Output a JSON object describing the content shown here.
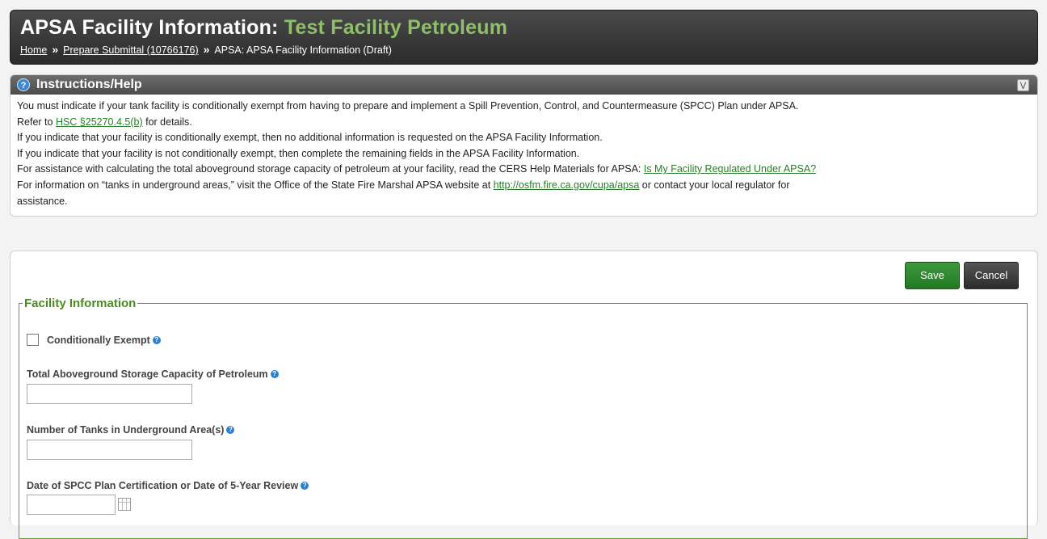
{
  "header": {
    "title_prefix": "APSA Facility Information: ",
    "facility_name": "Test Facility Petroleum",
    "breadcrumb": {
      "home": "Home",
      "sep": "»",
      "prepare": "Prepare Submittal (10766176)",
      "current": "APSA: APSA Facility Information (Draft)"
    }
  },
  "help": {
    "title": "Instructions/Help",
    "toggle_icon": "chevron-down-icon",
    "line1_a": "You must indicate if your tank facility is conditionally exempt from having to prepare and implement a Spill Prevention, Control, and Countermeasure (SPCC) Plan under APSA.",
    "line1_b_prefix": "Refer to ",
    "line1_b_link": "HSC §25270.4.5(b)",
    "line1_b_suffix": " for details.",
    "line2": "If you indicate that your facility is conditionally exempt, then no additional information is requested on the APSA Facility Information.",
    "line3": "If you indicate that your facility is not conditionally exempt, then complete the remaining fields in the APSA Facility Information.",
    "line4_prefix": "For assistance with calculating the total aboveground storage capacity of petroleum at your facility, read the CERS Help Materials for APSA: ",
    "line4_link": "Is My Facility Regulated Under APSA?",
    "line5_prefix": "For information on “tanks in underground areas,” visit the Office of the State Fire Marshal APSA website at ",
    "line5_link": "http://osfm.fire.ca.gov/cupa/apsa",
    "line5_suffix": " or contact your local regulator for",
    "line6": "assistance."
  },
  "toolbar": {
    "save_label": "Save",
    "cancel_label": "Cancel"
  },
  "form": {
    "legend": "Facility Information",
    "exempt_label": "Conditionally Exempt",
    "capacity_label": "Total Aboveground Storage Capacity of Petroleum",
    "capacity_value": "",
    "tanks_label": "Number of Tanks in Underground Area(s)",
    "tanks_value": "",
    "date_label": "Date of SPCC Plan Certification or Date of 5-Year Review",
    "date_value": ""
  }
}
